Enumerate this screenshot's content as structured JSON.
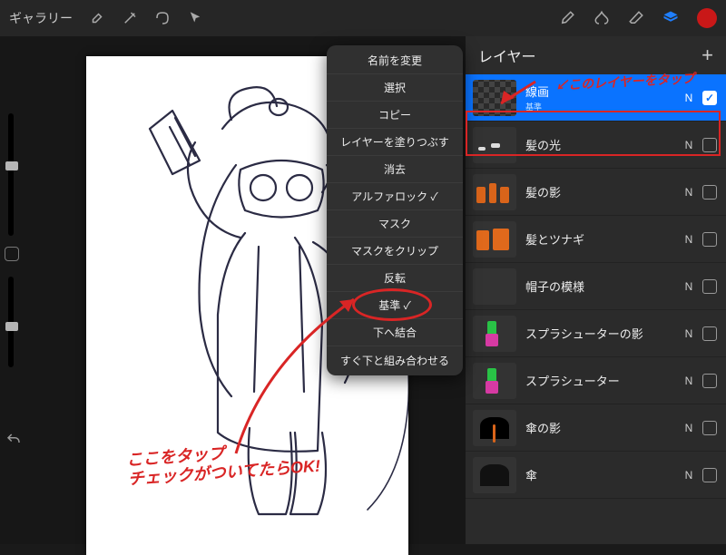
{
  "topbar": {
    "gallery": "ギャラリー"
  },
  "panel": {
    "title": "レイヤー"
  },
  "layers": [
    {
      "name": "線画",
      "sub": "基準",
      "blend": "N",
      "checked": true,
      "selected": true,
      "thumb": "trans"
    },
    {
      "name": "髪の光",
      "blend": "N",
      "checked": false
    },
    {
      "name": "髪の影",
      "blend": "N",
      "checked": false
    },
    {
      "name": "髪とツナギ",
      "blend": "N",
      "checked": false
    },
    {
      "name": "帽子の模様",
      "blend": "N",
      "checked": false
    },
    {
      "name": "スプラシューターの影",
      "blend": "N",
      "checked": false
    },
    {
      "name": "スプラシューター",
      "blend": "N",
      "checked": false
    },
    {
      "name": "傘の影",
      "blend": "N",
      "checked": false
    },
    {
      "name": "傘",
      "blend": "N",
      "checked": false
    }
  ],
  "ctx": [
    "名前を変更",
    "選択",
    "コピー",
    "レイヤーを塗りつぶす",
    "消去",
    "アルファロック ✓",
    "マスク",
    "マスクをクリップ",
    "反転",
    "基準 ✓",
    "下へ結合",
    "すぐ下と組み合わせる"
  ],
  "annotations": {
    "tap_layer": "↙このレイヤーをタップ",
    "tap_here": "ここをタップ\nチェックがついてたらOK!"
  }
}
